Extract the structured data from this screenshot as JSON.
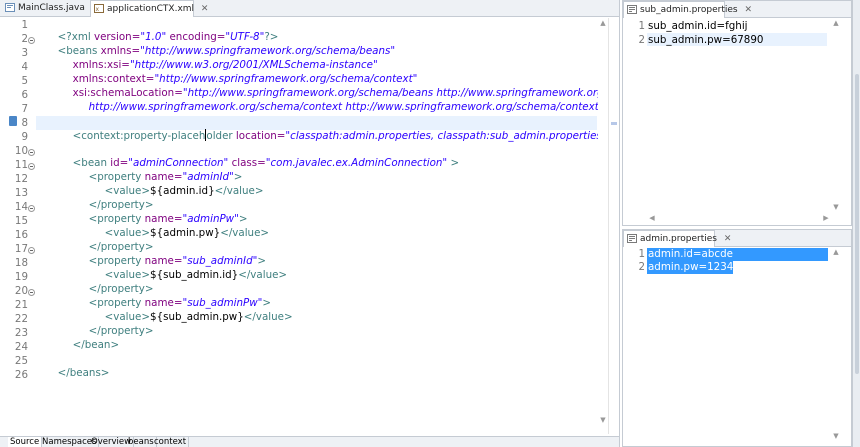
{
  "editor": {
    "tabs": [
      {
        "label": "MainClass.java",
        "active": false
      },
      {
        "label": "applicationCTX.xml",
        "active": true,
        "close": "✕"
      }
    ],
    "bottom_tabs": [
      "Source",
      "Namespaces",
      "Overview",
      "beans",
      "context"
    ],
    "line_numbers": [
      "1",
      "2",
      "3",
      "4",
      "5",
      "6",
      "7",
      "8",
      "9",
      "10",
      "11",
      "12",
      "13",
      "14",
      "15",
      "16",
      "17",
      "18",
      "19",
      "20",
      "21",
      "22",
      "23",
      "24",
      "25",
      "26"
    ],
    "lines": {
      "l1_a": "<?xml",
      "l1_b": " version=",
      "l1_c": "\"1.0\"",
      "l1_d": " encoding=",
      "l1_e": "\"UTF-8\"",
      "l1_f": "?>",
      "l2_a": "<beans",
      "l2_b": " xmlns=",
      "l2_c": "\"http://www.springframework.org/schema/beans\"",
      "l3_a": "xmlns:xsi=",
      "l3_b": "\"http://www.w3.org/2001/XMLSchema-instance\"",
      "l4_a": "xmlns:context=",
      "l4_b": "\"http://www.springframework.org/schema/context\"",
      "l5_a": "xsi:schemaLocation=",
      "l5_b": "\"http://www.springframework.org/schema/beans http://www.springframework.org/schema/",
      "l6_a": "http://www.springframework.org/schema/context http://www.springframework.org/schema/context/spring-c",
      "l8_a": "<context:property-placeh",
      "l8_b": "older",
      "l8_c": " location=",
      "l8_d": "\"classpath:admin.properties, classpath:sub_admin.properties\"",
      "l8_e": " />",
      "l10_a": "<b",
      "l10_b": "ean",
      "l10_c": " id=",
      "l10_d": "\"adminConnection\"",
      "l10_e": " class=",
      "l10_f": "\"com.javalec.ex.AdminConnection\"",
      "l10_g": " >",
      "l11_a": "<property",
      "l11_b": " name=",
      "l11_c": "\"adminId\"",
      "l11_d": ">",
      "l12_a": "<value>",
      "l12_b": "${admin.id}",
      "l12_c": "</value>",
      "l13_a": "</property>",
      "l14_a": "<property",
      "l14_b": " name=",
      "l14_c": "\"adminPw\"",
      "l14_d": ">",
      "l15_a": "<value>",
      "l15_b": "${admin.pw}",
      "l15_c": "</value>",
      "l16_a": "</property>",
      "l17_a": "<property",
      "l17_b": " name=",
      "l17_c": "\"sub_adminId\"",
      "l17_d": ">",
      "l18_a": "<value>",
      "l18_b": "${sub_admin.id}",
      "l18_c": "</value>",
      "l19_a": "</property>",
      "l20_a": "<property",
      "l20_b": " name=",
      "l20_c": "\"sub_adminPw\"",
      "l20_d": ">",
      "l21_a": "<value>",
      "l21_b": "${sub_admin.pw}",
      "l21_c": "</value>",
      "l22_a": "</property>",
      "l23_a": "</bean>",
      "l25_a": "</beans>"
    }
  },
  "sub_admin_pane": {
    "tab": "sub_admin.properties",
    "close": "✕",
    "line_numbers": [
      "1",
      "2"
    ],
    "lines": [
      "sub_admin.id=fghij",
      "sub_admin.pw=67890"
    ]
  },
  "admin_pane": {
    "tab": "admin.properties",
    "close": "✕",
    "line_numbers": [
      "1",
      "2"
    ],
    "lines": [
      "admin.id=abcde",
      "admin.pw=12345"
    ]
  },
  "colors": {
    "tag": "#3f7f7f",
    "attr_name": "#7f007f",
    "attr_value": "#2a00ff",
    "selection": "#3399ff",
    "current_line": "#e8f2fe"
  }
}
